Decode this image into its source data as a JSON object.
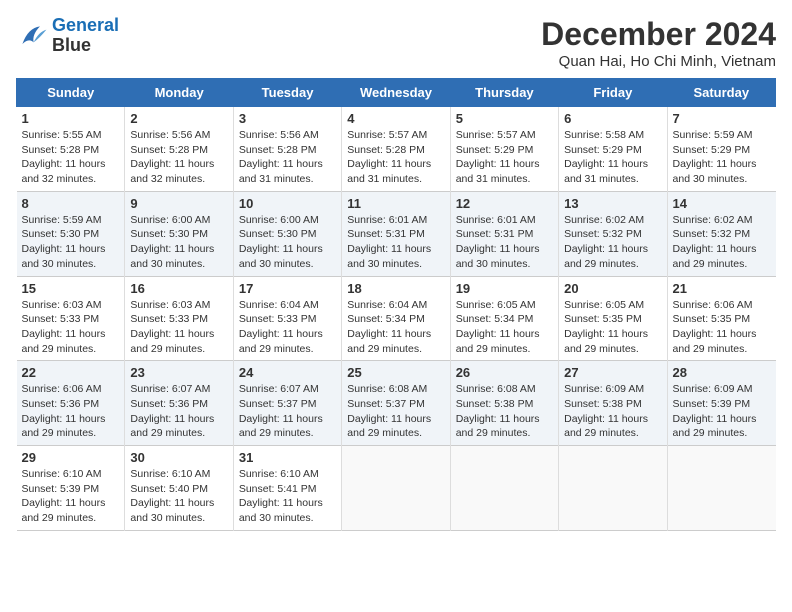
{
  "logo": {
    "line1": "General",
    "line2": "Blue"
  },
  "title": "December 2024",
  "subtitle": "Quan Hai, Ho Chi Minh, Vietnam",
  "weekdays": [
    "Sunday",
    "Monday",
    "Tuesday",
    "Wednesday",
    "Thursday",
    "Friday",
    "Saturday"
  ],
  "weeks": [
    [
      {
        "day": "1",
        "sunrise": "Sunrise: 5:55 AM",
        "sunset": "Sunset: 5:28 PM",
        "daylight": "Daylight: 11 hours and 32 minutes."
      },
      {
        "day": "2",
        "sunrise": "Sunrise: 5:56 AM",
        "sunset": "Sunset: 5:28 PM",
        "daylight": "Daylight: 11 hours and 32 minutes."
      },
      {
        "day": "3",
        "sunrise": "Sunrise: 5:56 AM",
        "sunset": "Sunset: 5:28 PM",
        "daylight": "Daylight: 11 hours and 31 minutes."
      },
      {
        "day": "4",
        "sunrise": "Sunrise: 5:57 AM",
        "sunset": "Sunset: 5:28 PM",
        "daylight": "Daylight: 11 hours and 31 minutes."
      },
      {
        "day": "5",
        "sunrise": "Sunrise: 5:57 AM",
        "sunset": "Sunset: 5:29 PM",
        "daylight": "Daylight: 11 hours and 31 minutes."
      },
      {
        "day": "6",
        "sunrise": "Sunrise: 5:58 AM",
        "sunset": "Sunset: 5:29 PM",
        "daylight": "Daylight: 11 hours and 31 minutes."
      },
      {
        "day": "7",
        "sunrise": "Sunrise: 5:59 AM",
        "sunset": "Sunset: 5:29 PM",
        "daylight": "Daylight: 11 hours and 30 minutes."
      }
    ],
    [
      {
        "day": "8",
        "sunrise": "Sunrise: 5:59 AM",
        "sunset": "Sunset: 5:30 PM",
        "daylight": "Daylight: 11 hours and 30 minutes."
      },
      {
        "day": "9",
        "sunrise": "Sunrise: 6:00 AM",
        "sunset": "Sunset: 5:30 PM",
        "daylight": "Daylight: 11 hours and 30 minutes."
      },
      {
        "day": "10",
        "sunrise": "Sunrise: 6:00 AM",
        "sunset": "Sunset: 5:30 PM",
        "daylight": "Daylight: 11 hours and 30 minutes."
      },
      {
        "day": "11",
        "sunrise": "Sunrise: 6:01 AM",
        "sunset": "Sunset: 5:31 PM",
        "daylight": "Daylight: 11 hours and 30 minutes."
      },
      {
        "day": "12",
        "sunrise": "Sunrise: 6:01 AM",
        "sunset": "Sunset: 5:31 PM",
        "daylight": "Daylight: 11 hours and 30 minutes."
      },
      {
        "day": "13",
        "sunrise": "Sunrise: 6:02 AM",
        "sunset": "Sunset: 5:32 PM",
        "daylight": "Daylight: 11 hours and 29 minutes."
      },
      {
        "day": "14",
        "sunrise": "Sunrise: 6:02 AM",
        "sunset": "Sunset: 5:32 PM",
        "daylight": "Daylight: 11 hours and 29 minutes."
      }
    ],
    [
      {
        "day": "15",
        "sunrise": "Sunrise: 6:03 AM",
        "sunset": "Sunset: 5:33 PM",
        "daylight": "Daylight: 11 hours and 29 minutes."
      },
      {
        "day": "16",
        "sunrise": "Sunrise: 6:03 AM",
        "sunset": "Sunset: 5:33 PM",
        "daylight": "Daylight: 11 hours and 29 minutes."
      },
      {
        "day": "17",
        "sunrise": "Sunrise: 6:04 AM",
        "sunset": "Sunset: 5:33 PM",
        "daylight": "Daylight: 11 hours and 29 minutes."
      },
      {
        "day": "18",
        "sunrise": "Sunrise: 6:04 AM",
        "sunset": "Sunset: 5:34 PM",
        "daylight": "Daylight: 11 hours and 29 minutes."
      },
      {
        "day": "19",
        "sunrise": "Sunrise: 6:05 AM",
        "sunset": "Sunset: 5:34 PM",
        "daylight": "Daylight: 11 hours and 29 minutes."
      },
      {
        "day": "20",
        "sunrise": "Sunrise: 6:05 AM",
        "sunset": "Sunset: 5:35 PM",
        "daylight": "Daylight: 11 hours and 29 minutes."
      },
      {
        "day": "21",
        "sunrise": "Sunrise: 6:06 AM",
        "sunset": "Sunset: 5:35 PM",
        "daylight": "Daylight: 11 hours and 29 minutes."
      }
    ],
    [
      {
        "day": "22",
        "sunrise": "Sunrise: 6:06 AM",
        "sunset": "Sunset: 5:36 PM",
        "daylight": "Daylight: 11 hours and 29 minutes."
      },
      {
        "day": "23",
        "sunrise": "Sunrise: 6:07 AM",
        "sunset": "Sunset: 5:36 PM",
        "daylight": "Daylight: 11 hours and 29 minutes."
      },
      {
        "day": "24",
        "sunrise": "Sunrise: 6:07 AM",
        "sunset": "Sunset: 5:37 PM",
        "daylight": "Daylight: 11 hours and 29 minutes."
      },
      {
        "day": "25",
        "sunrise": "Sunrise: 6:08 AM",
        "sunset": "Sunset: 5:37 PM",
        "daylight": "Daylight: 11 hours and 29 minutes."
      },
      {
        "day": "26",
        "sunrise": "Sunrise: 6:08 AM",
        "sunset": "Sunset: 5:38 PM",
        "daylight": "Daylight: 11 hours and 29 minutes."
      },
      {
        "day": "27",
        "sunrise": "Sunrise: 6:09 AM",
        "sunset": "Sunset: 5:38 PM",
        "daylight": "Daylight: 11 hours and 29 minutes."
      },
      {
        "day": "28",
        "sunrise": "Sunrise: 6:09 AM",
        "sunset": "Sunset: 5:39 PM",
        "daylight": "Daylight: 11 hours and 29 minutes."
      }
    ],
    [
      {
        "day": "29",
        "sunrise": "Sunrise: 6:10 AM",
        "sunset": "Sunset: 5:39 PM",
        "daylight": "Daylight: 11 hours and 29 minutes."
      },
      {
        "day": "30",
        "sunrise": "Sunrise: 6:10 AM",
        "sunset": "Sunset: 5:40 PM",
        "daylight": "Daylight: 11 hours and 30 minutes."
      },
      {
        "day": "31",
        "sunrise": "Sunrise: 6:10 AM",
        "sunset": "Sunset: 5:41 PM",
        "daylight": "Daylight: 11 hours and 30 minutes."
      },
      null,
      null,
      null,
      null
    ]
  ]
}
